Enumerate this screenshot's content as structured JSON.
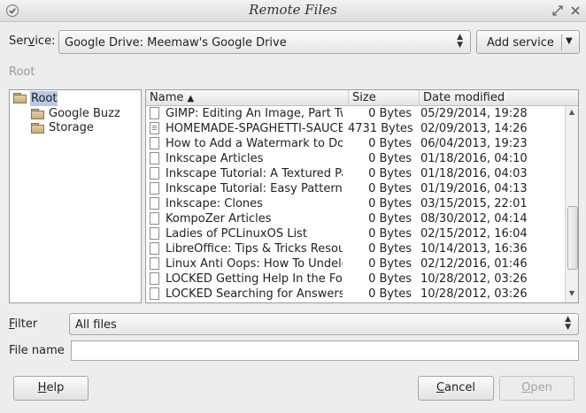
{
  "window": {
    "title": "Remote Files"
  },
  "service": {
    "label_pre": "Ser",
    "label_key": "v",
    "label_post": "ice:",
    "value": "Google Drive: Meemaw's Google Drive",
    "add_button": "Add service"
  },
  "location": {
    "path": "Root"
  },
  "tree": {
    "root": "Root",
    "items": [
      {
        "label": "Google Buzz"
      },
      {
        "label": "Storage"
      }
    ]
  },
  "files": {
    "columns": {
      "name": "Name",
      "size": "Size",
      "date": "Date modified"
    },
    "sort_indicator": "▲",
    "rows": [
      {
        "name": "GIMP: Editing An Image, Part Two",
        "size": "0 Bytes",
        "date": "05/29/2014, 19:28",
        "icon": "doc"
      },
      {
        "name": "HOMEMADE-SPAGHETTI-SAUCE",
        "size": "4731 Bytes",
        "date": "02/09/2013, 14:26",
        "icon": "text"
      },
      {
        "name": "How to Add a Watermark to Documents",
        "size": "0 Bytes",
        "date": "06/04/2013, 19:23",
        "icon": "doc"
      },
      {
        "name": "Inkscape Articles",
        "size": "0 Bytes",
        "date": "01/18/2016, 04:10",
        "icon": "doc"
      },
      {
        "name": "Inkscape Tutorial: A Textured Pattern",
        "size": "0 Bytes",
        "date": "01/18/2016, 04:03",
        "icon": "doc"
      },
      {
        "name": "Inkscape Tutorial: Easy Patterns",
        "size": "0 Bytes",
        "date": "01/19/2016, 04:13",
        "icon": "doc"
      },
      {
        "name": "Inkscape: Clones",
        "size": "0 Bytes",
        "date": "03/15/2015, 22:01",
        "icon": "doc"
      },
      {
        "name": "KompoZer Articles",
        "size": "0 Bytes",
        "date": "08/30/2012, 04:14",
        "icon": "doc"
      },
      {
        "name": "Ladies of PCLinuxOS List",
        "size": "0 Bytes",
        "date": "02/15/2012, 16:04",
        "icon": "doc"
      },
      {
        "name": "LibreOffice: Tips & Tricks Resources",
        "size": "0 Bytes",
        "date": "10/14/2013, 16:36",
        "icon": "doc"
      },
      {
        "name": "Linux Anti Oops: How To Undelete",
        "size": "0 Bytes",
        "date": "02/12/2016, 01:46",
        "icon": "doc"
      },
      {
        "name": "LOCKED Getting Help In the Forum",
        "size": "0 Bytes",
        "date": "10/28/2012, 03:26",
        "icon": "doc"
      },
      {
        "name": "LOCKED Searching for Answers",
        "size": "0 Bytes",
        "date": "10/28/2012, 03:26",
        "icon": "doc"
      }
    ]
  },
  "filter": {
    "label_key": "F",
    "label_rest": "ilter",
    "value": "All files"
  },
  "filename": {
    "label": "File name",
    "value": ""
  },
  "buttons": {
    "help_key": "H",
    "help_rest": "elp",
    "cancel_key": "C",
    "cancel_rest": "ancel",
    "open_key": "O",
    "open_rest": "pen"
  },
  "colors": {
    "selection": "#b9c9e3",
    "disabled_text": "#a3a3a3"
  }
}
